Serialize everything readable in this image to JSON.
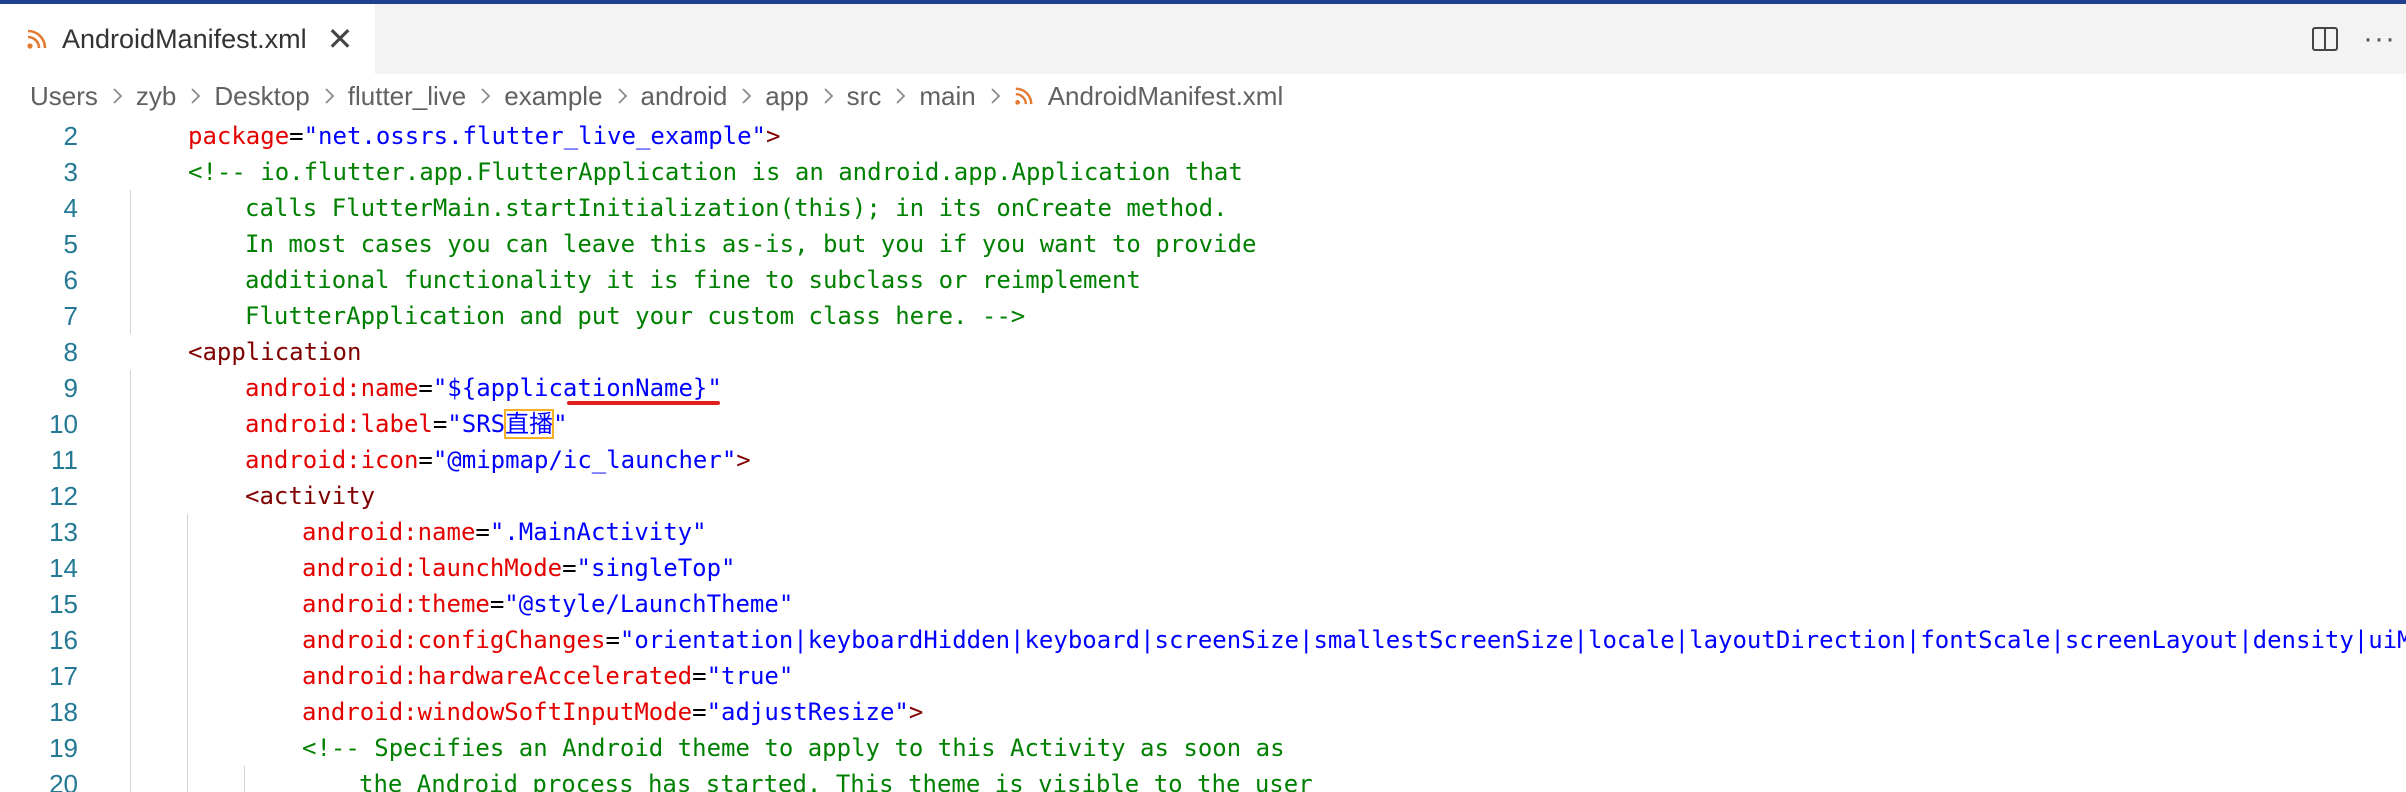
{
  "tab": {
    "title": "AndroidManifest.xml",
    "close_glyph": "✕",
    "icon": "rss-icon"
  },
  "actions": {
    "split_icon": "split-editor-icon",
    "more_glyph": "···"
  },
  "breadcrumb": {
    "items": [
      "Users",
      "zyb",
      "Desktop",
      "flutter_live",
      "example",
      "android",
      "app",
      "src",
      "main"
    ],
    "file": "AndroidManifest.xml"
  },
  "colors": {
    "tag": "#800000",
    "attr": "#e50000",
    "string": "#0000ff",
    "comment": "#008000",
    "line_number": "#237893"
  },
  "lines": [
    {
      "n": "2",
      "indent": 1,
      "segs": [
        [
          "attr",
          "package"
        ],
        [
          "pun",
          "="
        ],
        [
          "str",
          "\"net.ossrs.flutter_live_example\""
        ],
        [
          "tag",
          ">"
        ]
      ]
    },
    {
      "n": "3",
      "indent": 1,
      "segs": [
        [
          "cmt",
          "<!-- io.flutter.app.FlutterApplication is an android.app.Application that"
        ]
      ]
    },
    {
      "n": "4",
      "indent": 2,
      "segs": [
        [
          "cmt",
          "calls FlutterMain.startInitialization(this); in its onCreate method."
        ]
      ]
    },
    {
      "n": "5",
      "indent": 2,
      "segs": [
        [
          "cmt",
          "In most cases you can leave this as-is, but you if you want to provide"
        ]
      ]
    },
    {
      "n": "6",
      "indent": 2,
      "segs": [
        [
          "cmt",
          "additional functionality it is fine to subclass or reimplement"
        ]
      ]
    },
    {
      "n": "7",
      "indent": 2,
      "segs": [
        [
          "cmt",
          "FlutterApplication and put your custom class here. -->"
        ]
      ]
    },
    {
      "n": "8",
      "indent": 1,
      "segs": [
        [
          "tag",
          "<application"
        ]
      ]
    },
    {
      "n": "9",
      "indent": 2,
      "segs": [
        [
          "attr",
          "android:name"
        ],
        [
          "pun",
          "="
        ],
        [
          "str",
          "\"${applicationName}\""
        ]
      ]
    },
    {
      "n": "10",
      "indent": 2,
      "segs": [
        [
          "attr",
          "android:label"
        ],
        [
          "pun",
          "="
        ],
        [
          "str",
          "\"SRS"
        ],
        [
          "strbox",
          "直播"
        ],
        [
          "str",
          "\""
        ]
      ]
    },
    {
      "n": "11",
      "indent": 2,
      "segs": [
        [
          "attr",
          "android:icon"
        ],
        [
          "pun",
          "="
        ],
        [
          "str",
          "\"@mipmap/ic_launcher\""
        ],
        [
          "tag",
          ">"
        ]
      ]
    },
    {
      "n": "12",
      "indent": 2,
      "segs": [
        [
          "tag",
          "<activity"
        ]
      ]
    },
    {
      "n": "13",
      "indent": 3,
      "segs": [
        [
          "attr",
          "android:name"
        ],
        [
          "pun",
          "="
        ],
        [
          "str",
          "\".MainActivity\""
        ]
      ]
    },
    {
      "n": "14",
      "indent": 3,
      "segs": [
        [
          "attr",
          "android:launchMode"
        ],
        [
          "pun",
          "="
        ],
        [
          "str",
          "\"singleTop\""
        ]
      ]
    },
    {
      "n": "15",
      "indent": 3,
      "segs": [
        [
          "attr",
          "android:theme"
        ],
        [
          "pun",
          "="
        ],
        [
          "str",
          "\"@style/LaunchTheme\""
        ]
      ]
    },
    {
      "n": "16",
      "indent": 3,
      "segs": [
        [
          "attr",
          "android:configChanges"
        ],
        [
          "pun",
          "="
        ],
        [
          "str",
          "\"orientation|keyboardHidden|keyboard|screenSize|smallestScreenSize|locale|layoutDirection|fontScale|screenLayout|density|uiMode\""
        ]
      ]
    },
    {
      "n": "17",
      "indent": 3,
      "segs": [
        [
          "attr",
          "android:hardwareAccelerated"
        ],
        [
          "pun",
          "="
        ],
        [
          "str",
          "\"true\""
        ]
      ]
    },
    {
      "n": "18",
      "indent": 3,
      "segs": [
        [
          "attr",
          "android:windowSoftInputMode"
        ],
        [
          "pun",
          "="
        ],
        [
          "str",
          "\"adjustResize\""
        ],
        [
          "tag",
          ">"
        ]
      ]
    },
    {
      "n": "19",
      "indent": 3,
      "segs": [
        [
          "cmt",
          "<!-- Specifies an Android theme to apply to this Activity as soon as"
        ]
      ]
    },
    {
      "n": "20",
      "indent": 4,
      "segs": [
        [
          "cmt",
          "the Android process has started. This theme is visible to the user"
        ]
      ]
    }
  ]
}
